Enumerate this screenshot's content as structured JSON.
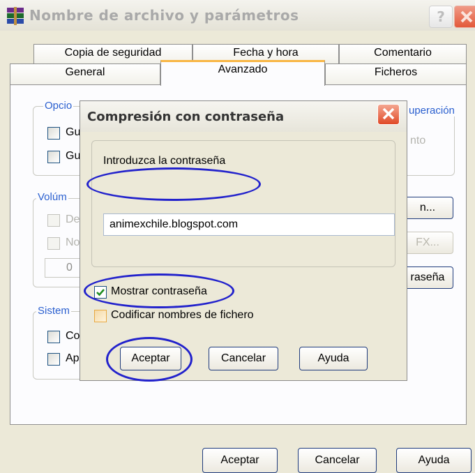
{
  "window": {
    "title": "Nombre de archivo y parámetros",
    "help_label": "?"
  },
  "tabs_top": [
    "Copia de seguridad",
    "Fecha y hora",
    "Comentario"
  ],
  "tabs_bottom": [
    "General",
    "Avanzado",
    "Ficheros"
  ],
  "active_tab": "Avanzado",
  "panel": {
    "group_options_legend": "Opcio",
    "option_items": [
      "Gu",
      "Gu"
    ],
    "group_recovery_legend": "uperación",
    "recovery_text": "nto",
    "group_volumes_legend": "Volúm",
    "volume_items": [
      "De",
      "No"
    ],
    "volume_value": "0",
    "btn_right_1": "n...",
    "btn_right_2": "FX...",
    "btn_right_3": "raseña",
    "group_system_legend": "Sistem",
    "system_items": [
      "Co",
      "Ap"
    ]
  },
  "modal": {
    "title": "Compresión con contraseña",
    "prompt_label": "Introduzca la contraseña",
    "password_value": "animexchile.blogspot.com",
    "show_password_label": "Mostrar contraseña",
    "encode_names_label": "Codificar nombres de fichero",
    "accept": "Aceptar",
    "cancel": "Cancelar",
    "help": "Ayuda"
  },
  "footer": {
    "accept": "Aceptar",
    "cancel": "Cancelar",
    "help": "Ayuda"
  },
  "colors": {
    "legend_blue": "#2a5fcf",
    "annotation_ellipse": "#2222cc",
    "active_tab_accent": "#f9b644"
  }
}
